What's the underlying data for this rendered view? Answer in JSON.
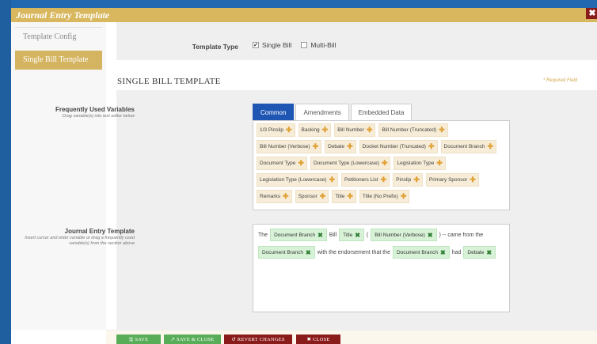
{
  "window": {
    "title": "Journal Entry Template",
    "close": "✖"
  },
  "sidebar": {
    "items": [
      {
        "label": "Template Config"
      },
      {
        "label": "Single Bill Template"
      }
    ]
  },
  "template_type": {
    "label": "Template Type",
    "options": [
      {
        "label": "Single Bill",
        "checked": true
      },
      {
        "label": "Multi-Bill",
        "checked": false
      }
    ]
  },
  "section": {
    "title": "SINGLE BILL TEMPLATE",
    "required_note": "* Required Field"
  },
  "frequent_vars": {
    "label": "Frequently Used Variables",
    "hint": "Drag variable(s) into text editor below",
    "tabs": [
      {
        "label": "Common"
      },
      {
        "label": "Amendments"
      },
      {
        "label": "Embedded Data"
      }
    ],
    "rows": [
      [
        "1/3 Pinslip",
        "Backing",
        "Bill Number",
        "Bill Number (Truncated)"
      ],
      [
        "Bill Number (Verbose)",
        "Debate",
        "Docket Number (Truncated)",
        "Document Branch"
      ],
      [
        "Document Type",
        "Document Type (Lowercase)",
        "Legislation Type"
      ],
      [
        "Legislation Type (Lowercase)",
        "Petitioners List",
        "Pinslip",
        "Primary Sponsor"
      ],
      [
        "Remarks",
        "Sponsor",
        "Title",
        "Title (No Prefix)"
      ]
    ]
  },
  "journal_template": {
    "label": "Journal Entry Template",
    "hint": "Insert cursor and enter variable or drag a frequently used variable(s) from the section above",
    "line1": {
      "t1": "The",
      "v1": "Document Branch",
      "t2": "Bill",
      "v2": "Title",
      "t3": "(",
      "v3": "Bill Number (Verbose)",
      "t4": ") -- came from the"
    },
    "line2": {
      "v1": "Document Branch",
      "t1": "with the endorsement that the",
      "v2": "Document Branch",
      "t2": "had",
      "v3": "Debate"
    }
  },
  "footer": {
    "save": "SAVE",
    "save_close": "SAVE & CLOSE",
    "revert": "REVERT CHANGES",
    "close": "CLOSE"
  }
}
